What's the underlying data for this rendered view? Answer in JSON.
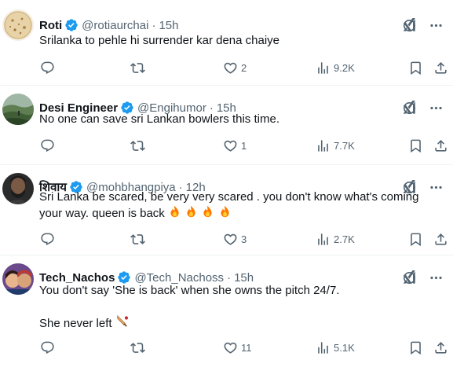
{
  "colors": {
    "text": "#0f1419",
    "muted": "#536471",
    "verified": "#1d9bf0",
    "divider": "#eff3f4",
    "fire": "#ff6a00"
  },
  "tweets": [
    {
      "name": "Roti",
      "handle": "@rotiaurchai",
      "time": "15h",
      "text": "Srilanka to pehle hi surrender kar dena chaiye",
      "likes": "2",
      "views": "9.2K",
      "avatar_icon": "roti-avatar"
    },
    {
      "name": "Desi Engineer",
      "handle": "@Engihumor",
      "time": "15h",
      "text": "No one can save sri Lankan bowlers this time.",
      "likes": "1",
      "views": "7.7K",
      "avatar_icon": "landscape-avatar"
    },
    {
      "name": "शिवाय",
      "handle": "@mohbhangpiya",
      "time": "12h",
      "text_line1": "Sri Lanka be scared, be very very scared . you don't know what's coming",
      "text_line2": "your way. queen is back",
      "likes": "3",
      "views": "2.7K",
      "emoji": "fire-icon"
    },
    {
      "name": "Tech_Nachos",
      "handle": "@Tech_Nachoss",
      "time": "15h",
      "text_line1": "You don't say 'She is back' when she owns the pitch 24/7.",
      "text_line2": "She never left",
      "likes": "11",
      "views": "5.1K",
      "emoji": "cricket-bat-icon"
    }
  ],
  "dot": "·"
}
